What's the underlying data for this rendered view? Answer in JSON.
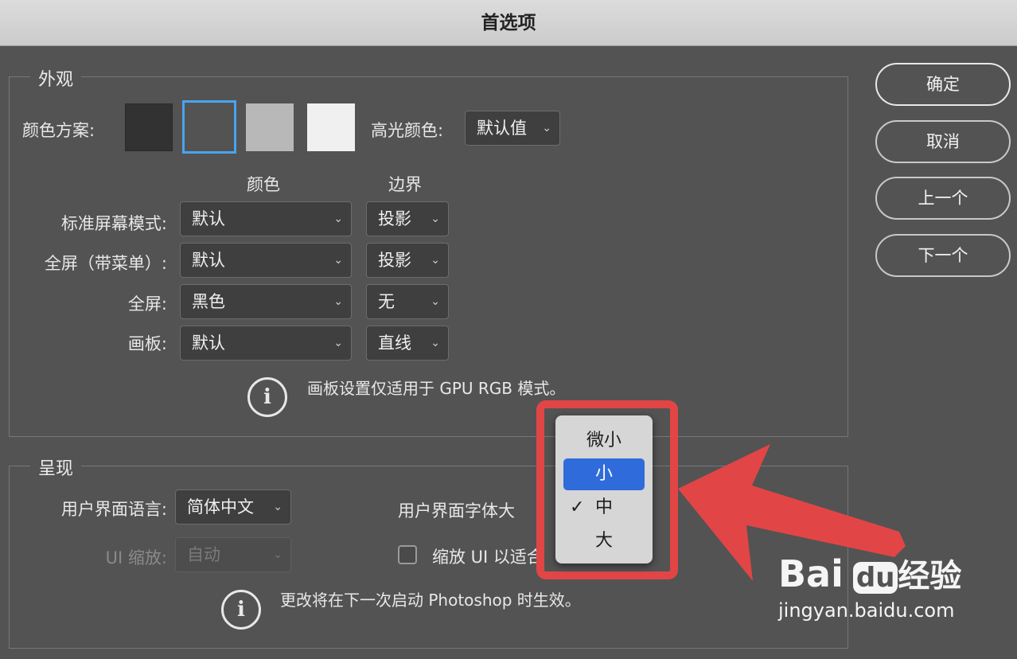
{
  "window": {
    "title": "首选项"
  },
  "appearance": {
    "legend": "外观",
    "color_scheme_label": "颜色方案:",
    "swatches": [
      {
        "name": "darkest",
        "color": "#323232"
      },
      {
        "name": "dark",
        "color": "#535353",
        "selected": true
      },
      {
        "name": "medium",
        "color": "#b8b8b8"
      },
      {
        "name": "light",
        "color": "#f0f0f0"
      }
    ],
    "highlight_label": "高光颜色:",
    "highlight_value": "默认值",
    "col_color": "颜色",
    "col_border": "边界",
    "rows": [
      {
        "label": "标准屏幕模式:",
        "color": "默认",
        "border": "投影"
      },
      {
        "label": "全屏（带菜单）:",
        "color": "默认",
        "border": "投影"
      },
      {
        "label": "全屏:",
        "color": "黑色",
        "border": "无"
      },
      {
        "label": "画板:",
        "color": "默认",
        "border": "直线"
      }
    ],
    "info_icon": "i",
    "info_text": "画板设置仅适用于 GPU RGB 模式。"
  },
  "presentation": {
    "legend": "呈现",
    "ui_language_label": "用户界面语言:",
    "ui_language_value": "简体中文",
    "ui_font_size_label": "用户界面字体大",
    "ui_scale_label": "UI 缩放:",
    "ui_scale_value": "自动",
    "scale_to_fit_label": "缩放 UI 以适合",
    "info_icon": "i",
    "info_text": "更改将在下一次启动 Photoshop 时生效。"
  },
  "font_size_menu": {
    "options": [
      {
        "label": "微小",
        "highlighted": false,
        "checked": false
      },
      {
        "label": "小",
        "highlighted": true,
        "checked": false
      },
      {
        "label": "中",
        "highlighted": false,
        "checked": true
      },
      {
        "label": "大",
        "highlighted": false,
        "checked": false
      }
    ],
    "check_mark": "✓"
  },
  "buttons": {
    "ok": "确定",
    "cancel": "取消",
    "prev": "上一个",
    "next": "下一个"
  },
  "watermark": {
    "brand_bai": "Bai",
    "brand_du": "du",
    "brand_cn": "经验",
    "url": "jingyan.baidu.com"
  },
  "colors": {
    "dialog_bg": "#535353",
    "accent_blue": "#2f6bdb",
    "selection_outline": "#4aa3f0",
    "annotation_red": "#e24545"
  }
}
